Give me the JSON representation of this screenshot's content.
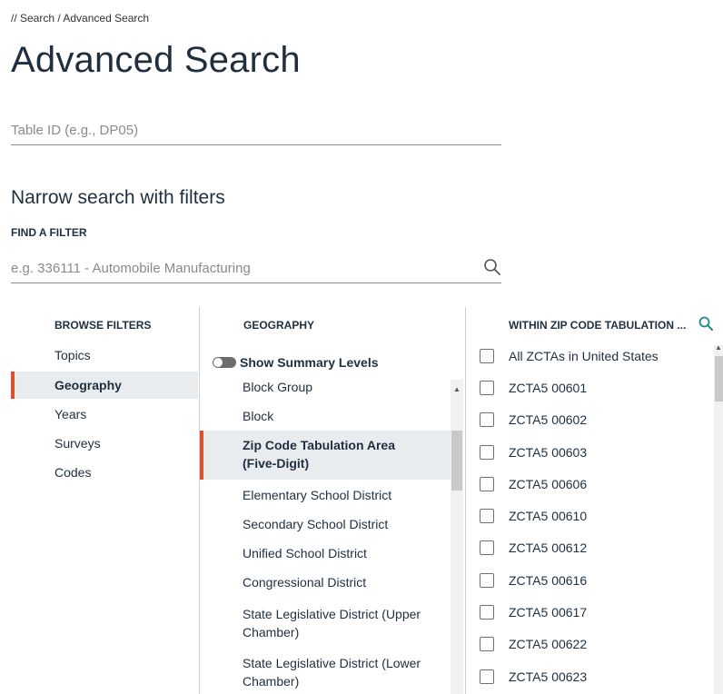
{
  "breadcrumb": "// Search / Advanced Search",
  "page_title": "Advanced Search",
  "table_id_placeholder": "Table ID (e.g., DP05)",
  "section_title": "Narrow search with filters",
  "find_filter_label": "FIND A FILTER",
  "filter_search_placeholder": "e.g. 336111 - Automobile Manufacturing",
  "browse": {
    "header": "BROWSE FILTERS",
    "items": [
      "Topics",
      "Geography",
      "Years",
      "Surveys",
      "Codes"
    ],
    "selected": "Geography"
  },
  "geography": {
    "header": "GEOGRAPHY",
    "toggle_label": "Show Summary Levels",
    "items": [
      "Block Group",
      "Block",
      "Zip Code Tabulation Area (Five-Digit)",
      "Elementary School District",
      "Secondary School District",
      "Unified School District",
      "Congressional District",
      "State Legislative District (Upper Chamber)",
      "State Legislative District (Lower Chamber)"
    ],
    "selected": "Zip Code Tabulation Area (Five-Digit)"
  },
  "within": {
    "header": "WITHIN ZIP CODE TABULATION ...",
    "items": [
      "All ZCTAs in United States",
      "ZCTA5 00601",
      "ZCTA5 00602",
      "ZCTA5 00603",
      "ZCTA5 00606",
      "ZCTA5 00610",
      "ZCTA5 00612",
      "ZCTA5 00616",
      "ZCTA5 00617",
      "ZCTA5 00622",
      "ZCTA5 00623"
    ]
  },
  "icons": {
    "search": "search-icon",
    "toggle": "toggle-switch",
    "scroll_up": "chevron-up-icon"
  },
  "colors": {
    "accent": "#d9512c",
    "teal_search": "#1f8a8a",
    "selected_bg": "#e9ecef"
  }
}
